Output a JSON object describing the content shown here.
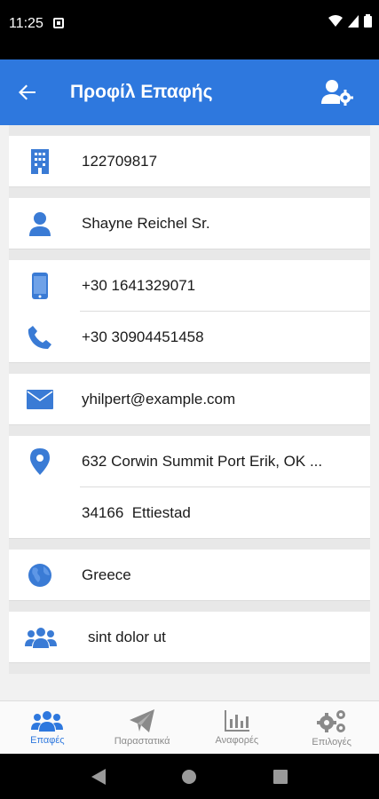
{
  "status_bar": {
    "time": "11:25"
  },
  "app_bar": {
    "title": "Προφίλ Επαφής",
    "back_icon": "arrow-back-icon",
    "settings_icon": "user-settings-icon"
  },
  "profile": {
    "company_id": "122709817",
    "name": "Shayne Reichel Sr.",
    "mobile": "+30 1641329071",
    "phone": "+30 30904451458",
    "email": "yhilpert@example.com",
    "address_line1": "632 Corwin Summit Port Erik, OK ...",
    "address_line2": "34166  Ettiestad",
    "country": "Greece",
    "group": "sint dolor ut"
  },
  "bottom_nav": {
    "items": [
      {
        "label": "Επαφές",
        "icon": "contacts-icon",
        "active": true
      },
      {
        "label": "Παραστατικά",
        "icon": "send-icon",
        "active": false
      },
      {
        "label": "Αναφορές",
        "icon": "bar-chart-icon",
        "active": false
      },
      {
        "label": "Επιλογές",
        "icon": "gears-icon",
        "active": false
      }
    ]
  },
  "colors": {
    "primary": "#2e78de",
    "icon_blue": "#3a7bd5",
    "inactive": "#8a8a8a"
  }
}
